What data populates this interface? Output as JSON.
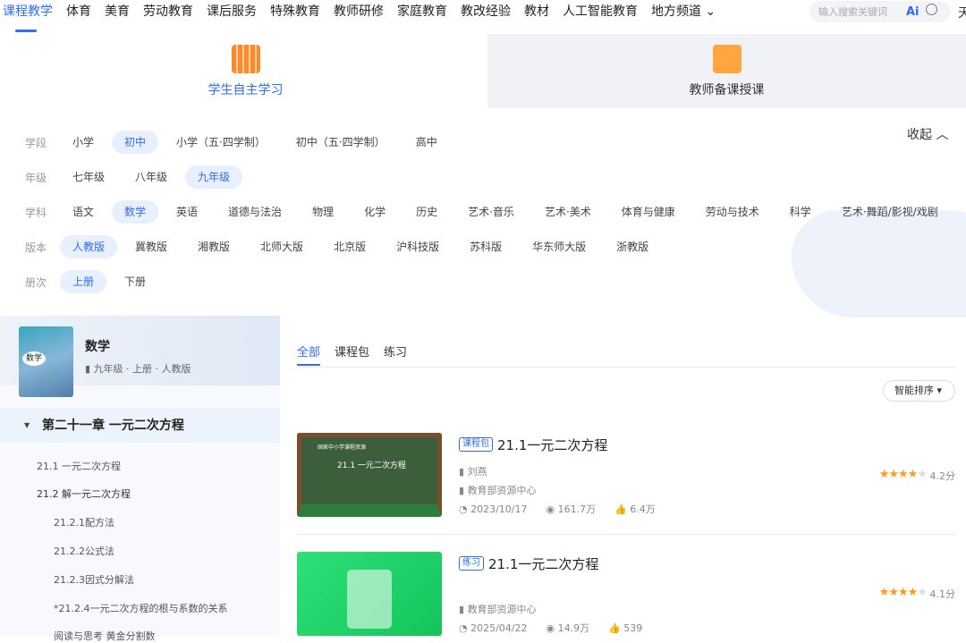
{
  "nav": {
    "items": [
      "课程教学",
      "体育",
      "美育",
      "劳动教育",
      "课后服务",
      "特殊教育",
      "教师研修",
      "家庭教育",
      "教改经验",
      "教材",
      "人工智能教育",
      "地方频道 ⌄"
    ],
    "search_placeholder": "输入搜索关键词",
    "ai_label": "Ai",
    "cut_text": "天"
  },
  "modes": {
    "student": "学生自主学习",
    "teacher": "教师备课授课"
  },
  "filters": [
    {
      "label": "学段",
      "options": [
        "小学",
        "初中",
        "小学（五·四学制）",
        "初中（五·四学制）",
        "高中"
      ],
      "selected": 1
    },
    {
      "label": "年级",
      "options": [
        "七年级",
        "八年级",
        "九年级"
      ],
      "selected": 2
    },
    {
      "label": "学科",
      "options": [
        "语文",
        "数学",
        "英语",
        "道德与法治",
        "物理",
        "化学",
        "历史",
        "艺术·音乐",
        "艺术·美术",
        "体育与健康",
        "劳动与技术",
        "科学",
        "艺术·舞蹈/影视/戏剧"
      ],
      "selected": 1
    },
    {
      "label": "版本",
      "options": [
        "人教版",
        "冀教版",
        "湘教版",
        "北师大版",
        "北京版",
        "沪科技版",
        "苏科版",
        "华东师大版",
        "浙教版"
      ],
      "selected": 0
    },
    {
      "label": "册次",
      "options": [
        "上册",
        "下册"
      ],
      "selected": 0
    }
  ],
  "collapse_label": "收起 ︿",
  "book": {
    "title": "数学",
    "subtitle": "九年级 · 上册 · 人教版",
    "cover_text": "数学"
  },
  "toc": {
    "chapter": "第二十一章 一元二次方程",
    "sections": [
      "21.1 一元二次方程",
      "21.2 解一元二次方程",
      "21.2.1配方法",
      "21.2.2公式法",
      "21.2.3因式分解法",
      "*21.2.4一元二次方程的根与系数的关系",
      "阅读与思考 黄金分割数"
    ]
  },
  "tabs": [
    "全部",
    "课程包",
    "练习"
  ],
  "sort_label": "智能排序 ▾",
  "results": [
    {
      "badge": "课程包",
      "title": "21.1一元二次方程",
      "author": "刘燕",
      "org": "教育部资源中心",
      "date": "2023/10/17",
      "views": "161.7万",
      "likes": "6.4万",
      "rating": 4.2,
      "score": "4.2分",
      "thumb_title": "21.1  一元二次方程",
      "thumb_header": "国家中小学课程资源"
    },
    {
      "badge": "练习",
      "title": "21.1一元二次方程",
      "org": "教育部资源中心",
      "date": "2025/04/22",
      "views": "14.9万",
      "likes": "539",
      "rating": 4.1,
      "score": "4.1分"
    }
  ]
}
